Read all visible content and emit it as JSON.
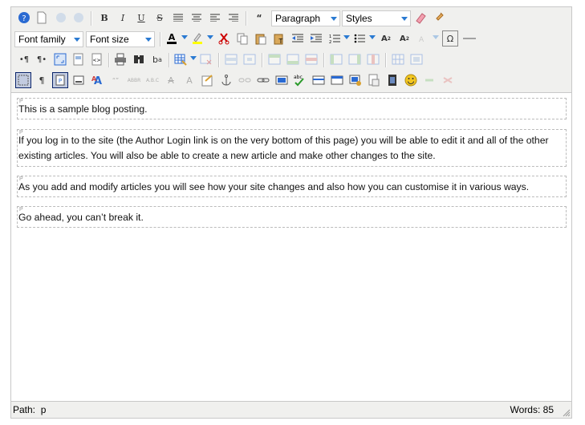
{
  "toolbar": {
    "row1": {
      "format_select": "Paragraph",
      "styles_select": "Styles"
    },
    "row2": {
      "font_family_select": "Font family",
      "font_size_select": "Font size"
    }
  },
  "content": {
    "paragraphs": [
      "This is a sample blog posting.",
      "If you log in to the site (the Author Login link is on the very bottom of this page) you will be able to edit it and all of the other existing articles. You will also be able to create a new article and make other changes to the site.",
      "As you add and modify articles you will see how your site changes and also how you can customise it in various ways.",
      "Go ahead, you can’t break it."
    ],
    "para_marker": "P"
  },
  "status": {
    "path_label": "Path:",
    "path_value": "p",
    "words": "Words: 85"
  },
  "colors": {
    "toolbar_bg": "#f0f0ee",
    "border": "#c8c8c8",
    "accent": "#2a7ad2"
  }
}
